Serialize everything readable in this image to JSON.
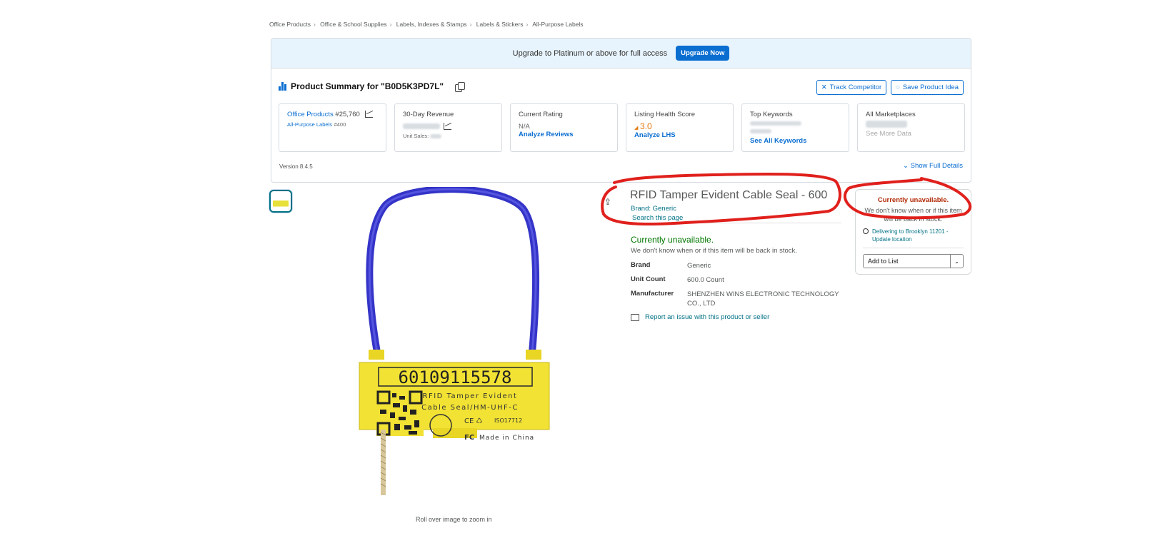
{
  "breadcrumb": [
    "Office Products",
    "Office & School Supplies",
    "Labels, Indexes & Stamps",
    "Labels & Stickers",
    "All-Purpose Labels"
  ],
  "upgrade": {
    "text": "Upgrade to Platinum or above for full access",
    "button": "Upgrade Now"
  },
  "summary": {
    "title": "Product Summary for \"B0D5K3PD7L\"",
    "track": "Track Competitor",
    "save": "Save Product Idea",
    "version": "Version 8.4.5",
    "show_full": "Show Full Details"
  },
  "cards": {
    "rank": {
      "category": "Office Products",
      "category_rank": "#25,760",
      "subcategory": "All-Purpose Labels",
      "subcategory_rank": "#400"
    },
    "revenue": {
      "title": "30-Day Revenue",
      "units_label": "Unit Sales:"
    },
    "rating": {
      "title": "Current Rating",
      "value": "N/A",
      "link": "Analyze Reviews"
    },
    "lhs": {
      "title": "Listing Health Score",
      "value": "3.0",
      "link": "Analyze LHS"
    },
    "keywords": {
      "title": "Top Keywords",
      "link": "See All Keywords"
    },
    "marketplaces": {
      "title": "All Marketplaces",
      "link": "See More Data"
    }
  },
  "product": {
    "title": "RFID Tamper Evident Cable Seal - 600",
    "brand_link": "Brand: Generic",
    "search_page": "Search this page",
    "availability": "Currently unavailable.",
    "availability_note": "We don't know when or if this item will be back in stock.",
    "specs": [
      {
        "key": "Brand",
        "value": "Generic"
      },
      {
        "key": "Unit Count",
        "value": "600.0 Count"
      },
      {
        "key": "Manufacturer",
        "value": "SHENZHEN WINS ELECTRONIC TECHNOLOGY CO., LTD"
      }
    ],
    "report": "Report an issue with this product or seller",
    "zoom_hint": "Roll over image to zoom in",
    "label_number": "60109115578",
    "label_line1": "RFID Tamper Evident",
    "label_line2": "Cable Seal/HM-UHF-C",
    "label_iso": "ISO17712",
    "label_origin": "Made in China"
  },
  "buybox": {
    "unavailable": "Currently unavailable.",
    "note": "We don't know when or if this item will be back in stock.",
    "deliver": "Delivering to Brooklyn 11201 - Update location",
    "add_to_list": "Add to List"
  },
  "colors": {
    "accent_blue": "#0a6ed1",
    "link_teal": "#007185",
    "available_green": "#007600",
    "unavailable_red": "#b12704",
    "annotation_red": "#e0201c"
  }
}
